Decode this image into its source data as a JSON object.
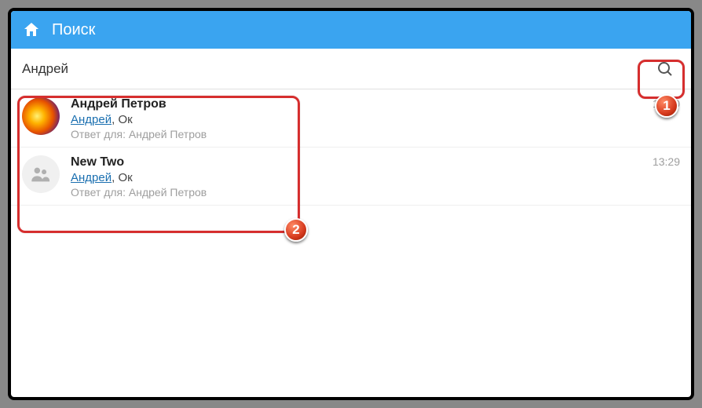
{
  "header": {
    "title": "Поиск"
  },
  "search": {
    "value": "Андрей",
    "placeholder": ""
  },
  "results": [
    {
      "name": "Андрей Петров",
      "link_text": "Андрей",
      "msg_rest": ", Ок",
      "reply": "Ответ для: Андрей Петров",
      "time": "13:20",
      "avatar_type": "tree"
    },
    {
      "name": "New Two",
      "link_text": "Андрей",
      "msg_rest": ", Ок",
      "reply": "Ответ для: Андрей Петров",
      "time": "13:29",
      "avatar_type": "group"
    }
  ],
  "annotations": {
    "badge1": "1",
    "badge2": "2"
  }
}
